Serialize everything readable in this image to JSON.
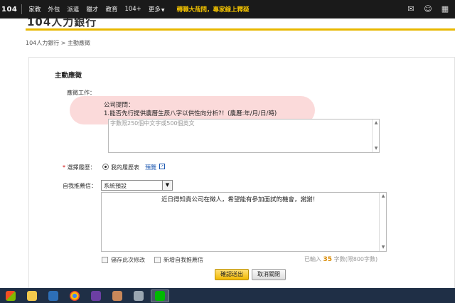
{
  "topbar": {
    "logo": "104",
    "nav": [
      "家教",
      "外包",
      "派遣",
      "獵才",
      "教育",
      "104+",
      "更多"
    ],
    "more_caret": "▼",
    "promo": "轉職大哉問，專家線上釋疑"
  },
  "brand": {
    "name": "104人力銀行"
  },
  "breadcrumb": "104人力銀行 > 主動應徵",
  "form": {
    "title": "主動應徵",
    "job_label": "應徵工作：",
    "question_title": "公司提問：",
    "question_text": "1.能否先行提供農曆生辰八字以供性向分析?！(農曆:年/月/日/時)",
    "answer_placeholder": "字數限250個中文字或500個英文",
    "resume_required": "*",
    "resume_label": "選擇履歷：",
    "resume_option": "我的履歷表",
    "preview_link": "預覽",
    "cover_letter_label": "自我推薦信：",
    "cover_letter_select": "系統預設",
    "cover_letter_text": "近日得知貴公司在徵人，希望能有參加面試的機會，謝謝！",
    "save_checkbox_label": "儲存此次修改",
    "add_checkbox_label": "新增自我推薦信",
    "count_prefix": "已輸入",
    "count_value": "35",
    "count_suffix": "字數(限800字數)",
    "submit_label": "確認送出",
    "cancel_label": "取消關閉"
  },
  "colors": {
    "accent": "#e8b800",
    "nav_bg": "#1a1a1a",
    "highlight": "#f49696",
    "link": "#1a56b0"
  }
}
